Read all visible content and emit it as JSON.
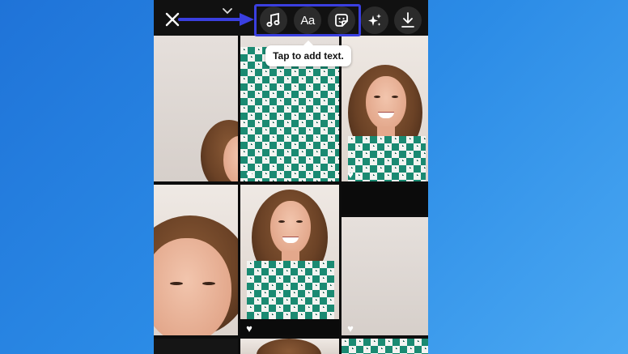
{
  "toolbar": {
    "close_icon": "close-icon",
    "expand_icon": "chevron-down-icon",
    "music_icon": "music-note-icon",
    "text_label": "Aa",
    "sticker_icon": "sticker-icon",
    "effects_icon": "sparkles-icon",
    "download_icon": "download-icon"
  },
  "tooltip": {
    "text": "Tap to add text."
  },
  "annotation": {
    "arrow_icon": "arrow-right-icon",
    "highlight_color": "#3a3fe0"
  },
  "colors": {
    "background_start": "#1f73d8",
    "background_end": "#4aa8f2",
    "canvas": "#0d0d0d",
    "button_bg": "#2b2b2b"
  }
}
